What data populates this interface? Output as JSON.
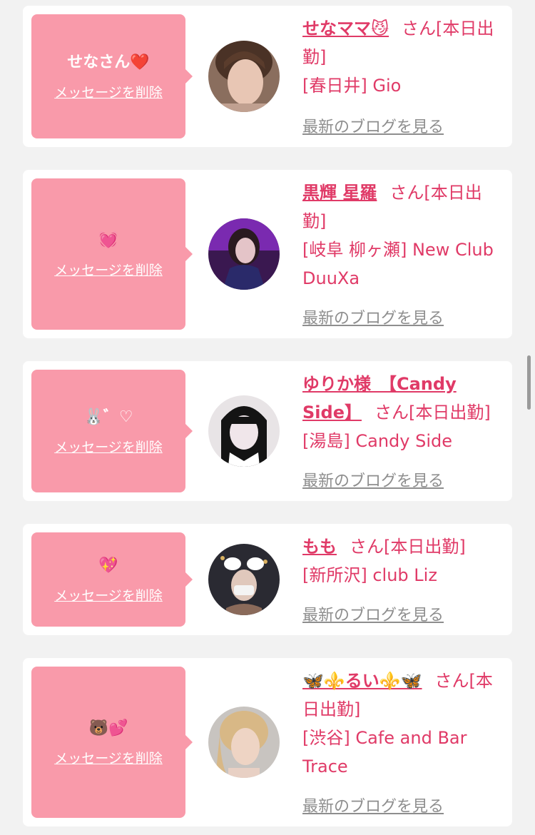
{
  "common": {
    "delete_label": "メッセージを削除",
    "blog_label": "最新のブログを見る"
  },
  "entries": [
    {
      "message": "せなさん",
      "message_emoji": "❤️",
      "name": "せなママ😼",
      "status": "さん[本日出勤]",
      "place": "[春日井] Gio"
    },
    {
      "message": "",
      "message_emoji": "💓",
      "name": "黒輝 星羅",
      "status": "さん[本日出勤]",
      "place": "[岐阜 柳ヶ瀬] New Club DuuXa"
    },
    {
      "message": "",
      "message_emoji": "🐰゛♡",
      "name": "ゆりか様　【Candy Side】",
      "status": "さん[本日出勤]",
      "place": "[湯島] Candy Side"
    },
    {
      "message": "",
      "message_emoji": "💖",
      "name": "もも",
      "status": "さん[本日出勤]",
      "place": "[新所沢] club Liz"
    },
    {
      "message": "",
      "message_emoji": "🐻💕",
      "name": "🦋⚜️るい⚜️🦋",
      "status": "さん[本日出勤]",
      "place": "[渋谷] Cafe and Bar Trace"
    }
  ],
  "colors": {
    "background": "#f2f2f2",
    "bubble": "#f99aaa",
    "accent": "#e03a67",
    "link_gray": "#8e8e8e"
  }
}
